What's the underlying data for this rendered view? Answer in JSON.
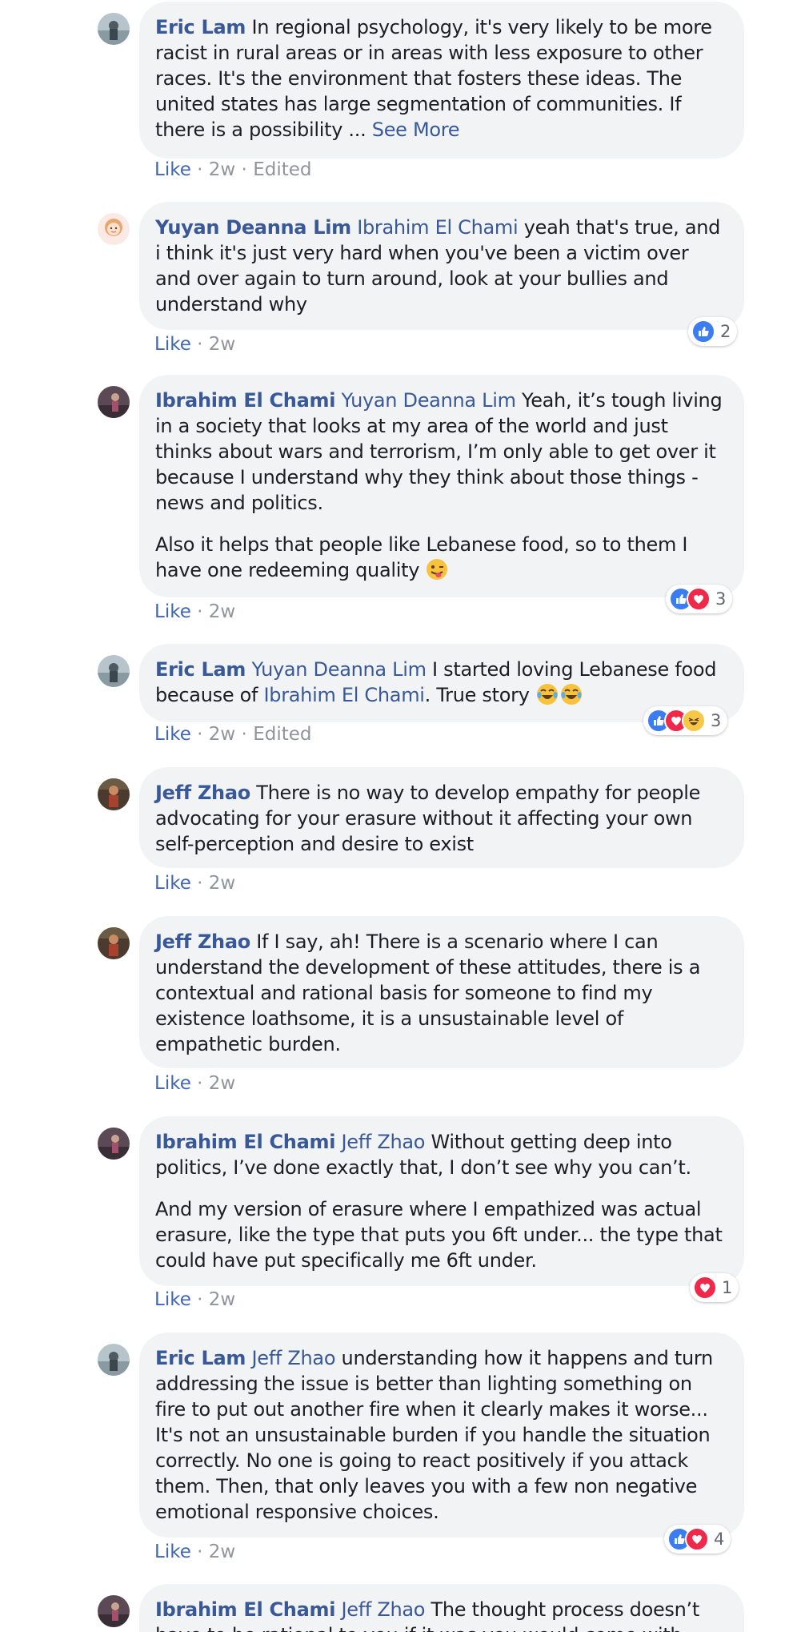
{
  "colors": {
    "link": "#385898",
    "like": "#4267b2",
    "meta": "#90949c",
    "bubble": "#f2f3f5"
  },
  "comments": [
    {
      "author": "Eric Lam",
      "paragraphs": [
        {
          "mention": "",
          "text": "In regional psychology, it's very likely to be more racist in rural areas or in areas with less exposure to other races. It's the environment that fosters these ideas. The united states has large segmentation of communities. If there is a possibility ...",
          "see_more": "See More"
        }
      ],
      "like": "Like",
      "time": "2w",
      "edited": "Edited"
    },
    {
      "author": "Yuyan Deanna Lim",
      "paragraphs": [
        {
          "mention": "Ibrahim El Chami",
          "text": "yeah that's true, and i think it's just very hard when you've been a victim over and over again to turn around, look at your bullies and understand why"
        }
      ],
      "like": "Like",
      "time": "2w",
      "reactions": {
        "types": [
          "like"
        ],
        "count": "2"
      }
    },
    {
      "author": "Ibrahim El Chami",
      "paragraphs": [
        {
          "mention": "Yuyan Deanna Lim",
          "text": "Yeah, it’s tough living in a society that looks at my area of the world and just thinks about wars and terrorism, I’m only able to get over it because I understand why they think about those things - news and politics."
        },
        {
          "text": "Also it helps that people like Lebanese food, so to them I have one redeeming quality",
          "emoji": [
            "tongue-wink-emoji"
          ]
        }
      ],
      "like": "Like",
      "time": "2w",
      "reactions": {
        "types": [
          "like",
          "love"
        ],
        "count": "3"
      }
    },
    {
      "author": "Eric Lam",
      "paragraphs": [
        {
          "mention": "Yuyan Deanna Lim",
          "text": "I started loving Lebanese food because of",
          "mention2": "Ibrahim El Chami",
          "text2": ". True story",
          "emoji": [
            "tears-of-joy-emoji",
            "tears-of-joy-emoji"
          ]
        }
      ],
      "like": "Like",
      "time": "2w",
      "edited": "Edited",
      "reactions": {
        "types": [
          "like",
          "love",
          "haha"
        ],
        "count": "3"
      }
    },
    {
      "author": "Jeff Zhao",
      "paragraphs": [
        {
          "mention": "",
          "text": "There is no way to develop empathy for people advocating for your erasure without it affecting your own self-perception and desire to exist"
        }
      ],
      "like": "Like",
      "time": "2w"
    },
    {
      "author": "Jeff Zhao",
      "paragraphs": [
        {
          "mention": "",
          "text": "If I say, ah! There is a scenario where I can understand the development of these attitudes, there is a contextual and rational basis for someone to find my existence loathsome, it is a unsustainable level of empathetic burden."
        }
      ],
      "like": "Like",
      "time": "2w"
    },
    {
      "author": "Ibrahim El Chami",
      "paragraphs": [
        {
          "mention": "Jeff Zhao",
          "text": "Without getting deep into politics, I’ve done exactly that, I don’t see why you can’t."
        },
        {
          "text": "And my version of erasure where I empathized was actual erasure, like the type that puts you 6ft under... the type that could have put specifically me 6ft under."
        }
      ],
      "like": "Like",
      "time": "2w",
      "reactions": {
        "types": [
          "love"
        ],
        "count": "1"
      }
    },
    {
      "author": "Eric Lam",
      "paragraphs": [
        {
          "mention": "Jeff Zhao",
          "text": "understanding how it happens and turn addressing the issue is better than lighting something on fire to put out another fire when it clearly makes it worse... It's not an unsustainable burden if you handle the situation correctly. No one is going to react positively if you attack them. Then, that only leaves you with a few non negative emotional responsive choices."
        }
      ],
      "like": "Like",
      "time": "2w",
      "reactions": {
        "types": [
          "like",
          "love"
        ],
        "count": "4"
      }
    },
    {
      "author": "Ibrahim El Chami",
      "paragraphs": [
        {
          "mention": "Jeff Zhao",
          "text": "The thought process doesn’t have to be rational to you if it was you would come with"
        }
      ]
    }
  ]
}
